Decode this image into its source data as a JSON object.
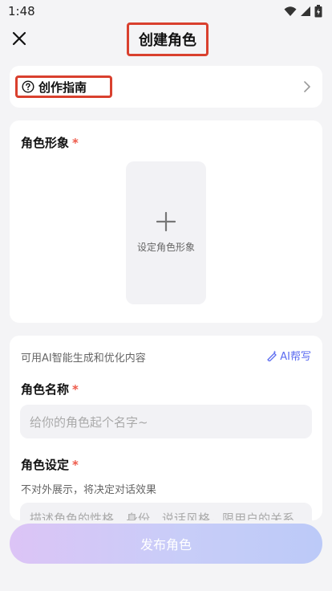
{
  "status_bar": {
    "time": "1:48"
  },
  "header": {
    "title": "创建角色"
  },
  "guide": {
    "label": "创作指南"
  },
  "avatar_section": {
    "label": "角色形象",
    "required_mark": "*",
    "upload_label": "设定角色形象"
  },
  "form": {
    "ai_hint": "可用AI智能生成和优化内容",
    "ai_help_label": "AI帮写",
    "name_label": "角色名称",
    "name_required": "*",
    "name_placeholder": "给你的角色起个名字~",
    "setting_label": "角色设定",
    "setting_required": "*",
    "setting_desc": "不对外展示，将决定对话效果",
    "setting_placeholder": "描述角色的性格、身份、说话风格，限用户的关系等"
  },
  "publish_button": {
    "label": "发布角色"
  },
  "colors": {
    "highlight": "#d9402e",
    "required": "#ee5a4a",
    "ai_accent": "#5b6bf0",
    "background": "#f4f4f6"
  },
  "icons": [
    "close-icon",
    "help-circle-icon",
    "chevron-right-icon",
    "plus-icon",
    "magic-pen-icon",
    "wifi-icon",
    "signal-icon",
    "battery-icon"
  ]
}
